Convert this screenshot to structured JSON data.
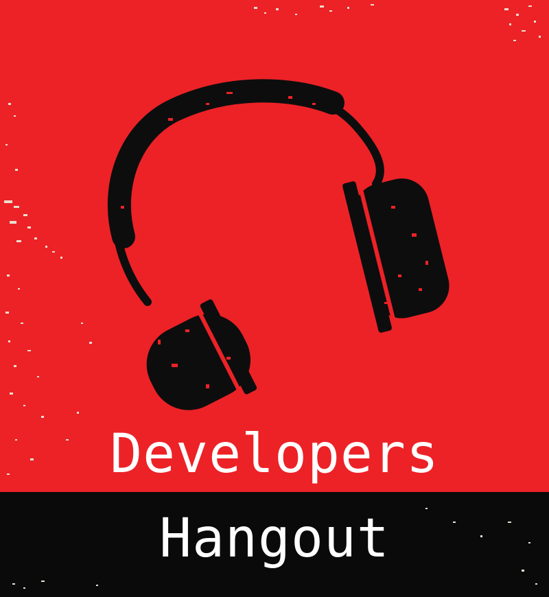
{
  "cover": {
    "title_line_1": "Developers",
    "title_line_2": "Hangout",
    "icon": "headphones-icon"
  },
  "colors": {
    "background_red": "#ec2227",
    "bar_black": "#0a0a0a",
    "text_white": "#ffffff",
    "speckle_beige": "#e9e0cf",
    "ink_black": "#0d0d0d"
  }
}
